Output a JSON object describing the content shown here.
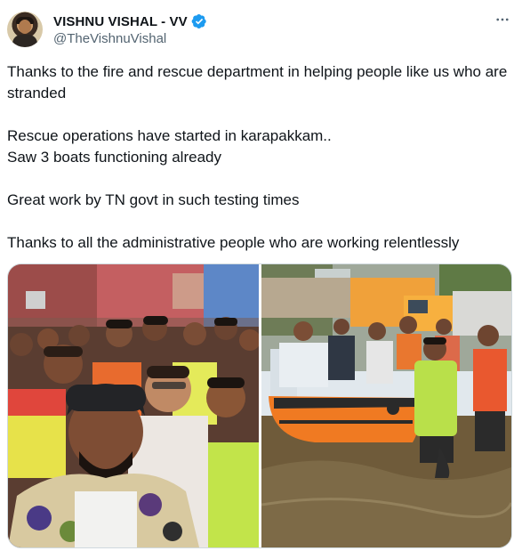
{
  "author": {
    "display_name": "VISHNU VISHAL - VV",
    "handle": "@TheVishnuVishal",
    "verified": true,
    "verified_color": "#1d9bf0"
  },
  "icons": {
    "avatar": "avatar-photo",
    "verified": "verified-badge-icon",
    "more": "more-horizontal-icon"
  },
  "tweet": {
    "paragraphs": [
      "Thanks to the fire and rescue department in helping people like us who are stranded",
      "Rescue operations have started in karapakkam..",
      "Saw 3 boats functioning already",
      "Great work by TN govt in such testing times",
      "Thanks to all the administrative people who are working relentlessly"
    ]
  },
  "media": {
    "count": 2,
    "images": [
      {
        "name": "group-selfie-photo"
      },
      {
        "name": "rescue-boat-photo"
      }
    ]
  },
  "colors": {
    "text_primary": "#0f1419",
    "text_secondary": "#536471",
    "border": "#cfd9de"
  }
}
